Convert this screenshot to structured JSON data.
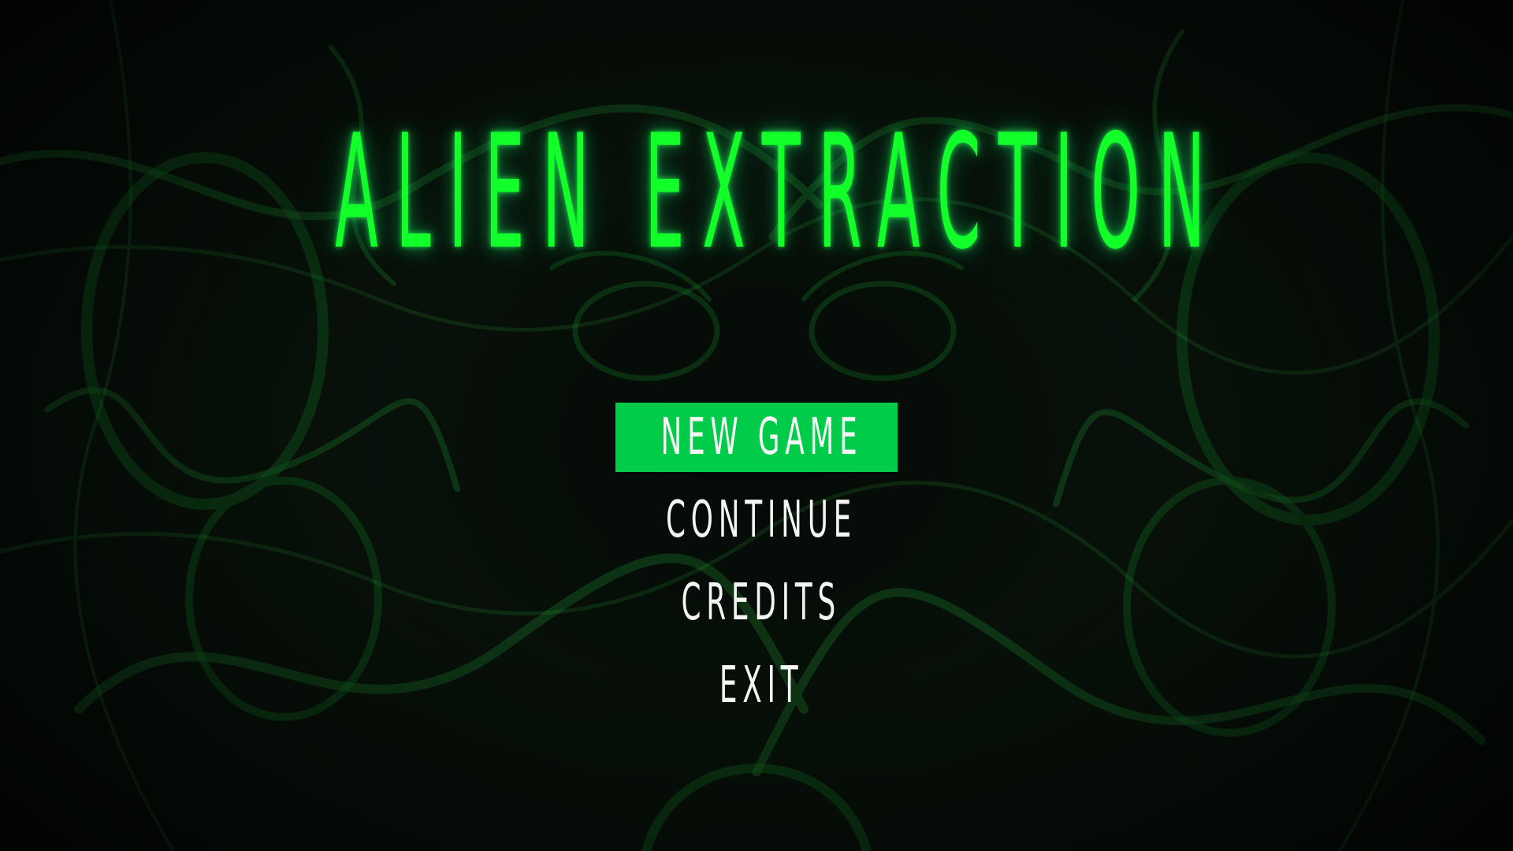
{
  "game": {
    "title": "ALIEN EXTRACTION"
  },
  "menu": {
    "items": [
      {
        "label": "NEW GAME",
        "selected": true
      },
      {
        "label": "CONTINUE",
        "selected": false
      },
      {
        "label": "CREDITS",
        "selected": false
      },
      {
        "label": "EXIT",
        "selected": false
      }
    ]
  },
  "colors": {
    "title": "#12ff2a",
    "highlight": "#00cc4a",
    "menu_text": "#f4f4f4",
    "background": "#070b08"
  }
}
